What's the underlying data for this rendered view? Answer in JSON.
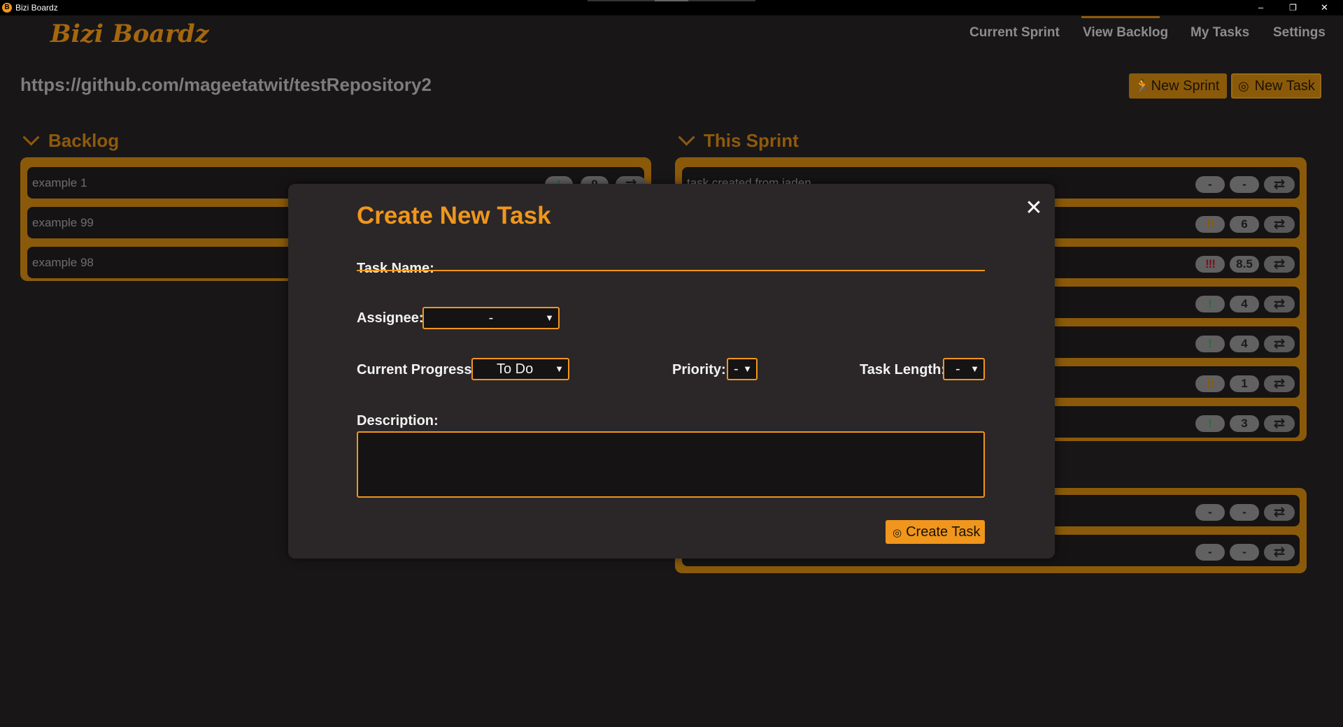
{
  "window": {
    "title": "Bizi Boardz",
    "icon_letter": "B",
    "minimize": "–",
    "restore": "❐",
    "close": "✕"
  },
  "header": {
    "brand": "Bizi Boardz",
    "nav": [
      "Current Sprint",
      "View Backlog",
      "My Tasks",
      "Settings"
    ],
    "active_nav": "View Backlog"
  },
  "repo_url": "https://github.com/mageetatwit/testRepository2",
  "buttons": {
    "new_sprint": "New Sprint",
    "new_sprint_icon": "running-person-icon",
    "new_task": "New Task",
    "new_task_icon": "target-icon"
  },
  "backlog": {
    "title": "Backlog",
    "items": [
      {
        "label": "example 1",
        "priority": "!",
        "length": "9"
      },
      {
        "label": "example 99",
        "priority": "",
        "length": ""
      },
      {
        "label": "example 98",
        "priority": "",
        "length": ""
      }
    ]
  },
  "sprint": {
    "title": "This Sprint",
    "items": [
      {
        "label": "task created from jaden",
        "priority": "-",
        "length": "-"
      },
      {
        "label": "",
        "priority": "!!",
        "length": "6"
      },
      {
        "label": "",
        "priority": "!!!",
        "length": "8.5"
      },
      {
        "label": "",
        "priority": "!",
        "length": "4"
      },
      {
        "label": "",
        "priority": "!",
        "length": "4"
      },
      {
        "label": "",
        "priority": "!!",
        "length": "1"
      },
      {
        "label": "",
        "priority": "!",
        "length": "3"
      }
    ]
  },
  "lower_panel": {
    "items": [
      {
        "label": "",
        "priority": "-",
        "length": "-"
      },
      {
        "label": "",
        "priority": "-",
        "length": "-"
      }
    ]
  },
  "swap_icon": "⇄",
  "modal": {
    "title": "Create New Task",
    "close": "✕",
    "task_name_label": "Task Name:",
    "task_name_value": "",
    "assignee_label": "Assignee:",
    "assignee_value": "-",
    "progress_label": "Current Progress:",
    "progress_value": "To Do",
    "priority_label": "Priority:",
    "priority_value": "-",
    "length_label": "Task Length:",
    "length_value": "-",
    "description_label": "Description:",
    "description_value": "",
    "create_button": "Create Task",
    "create_icon": "target-icon"
  },
  "colors": {
    "accent": "#f0961c",
    "accent_dim": "#8a5a0a",
    "background": "#181617",
    "modal_bg": "#2b2728"
  }
}
